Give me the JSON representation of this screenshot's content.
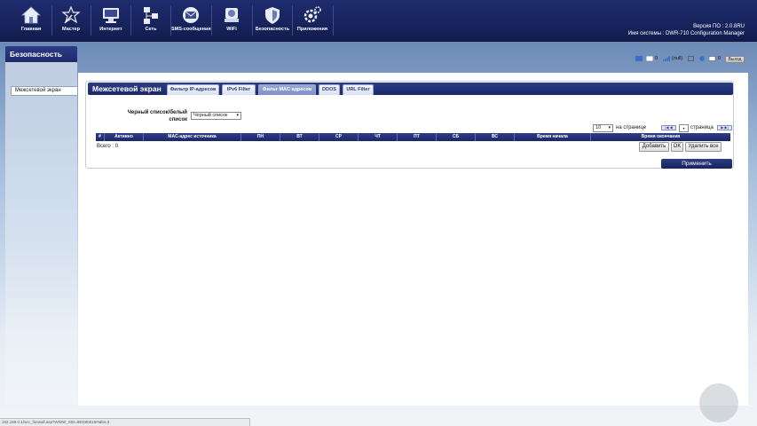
{
  "nav": {
    "items": [
      {
        "label": "Главная",
        "icon": "home-icon"
      },
      {
        "label": "Мастер",
        "icon": "wizard-icon"
      },
      {
        "label": "Интернет",
        "icon": "monitor-icon"
      },
      {
        "label": "Сеть",
        "icon": "network-icon"
      },
      {
        "label": "SMS-сообщения",
        "icon": "mail-icon"
      },
      {
        "label": "WiFi",
        "icon": "wifi-icon"
      },
      {
        "label": "Безопасность",
        "icon": "shield-icon"
      },
      {
        "label": "Приложения",
        "icon": "gear-icon"
      }
    ]
  },
  "fw_info": {
    "version": "Версия ПО : 2.0.8RU",
    "system_name": "Имя системы : DWR-710 Configuration Manager"
  },
  "section": {
    "title": "Безопасность"
  },
  "sidebar": {
    "item": "Межсетевой экран"
  },
  "status": {
    "sms_count": "0",
    "signal": "(null)",
    "msg_count": "0",
    "logout": "Выход"
  },
  "firewall": {
    "title": "Межсетевой экран",
    "tabs": [
      "Фильтр IP-адресов",
      "IPv6 Filter",
      "Фильт MAC адресов",
      "DDOS",
      "URL Filter"
    ],
    "active_tab": 2,
    "bw_label": "Черный список/белый список",
    "bw_value": "Черный список",
    "per_page_value": "10",
    "per_page_label": "на странице",
    "page_label": "страница",
    "columns": [
      "#",
      "Активно",
      "MAC-адрес источника",
      "ПН",
      "ВТ",
      "СР",
      "ЧТ",
      "ПТ",
      "СБ",
      "ВС",
      "Время начала",
      "Время окончания"
    ],
    "total": "Всего : 0",
    "buttons": {
      "add": "Добавить",
      "ok": "OK",
      "delete_all": "Удалить все"
    },
    "apply": "Применить"
  },
  "url_bar": "192.168.0.1/sec_firewall.asp?WWW_SID=8ED80516#tabs-3"
}
